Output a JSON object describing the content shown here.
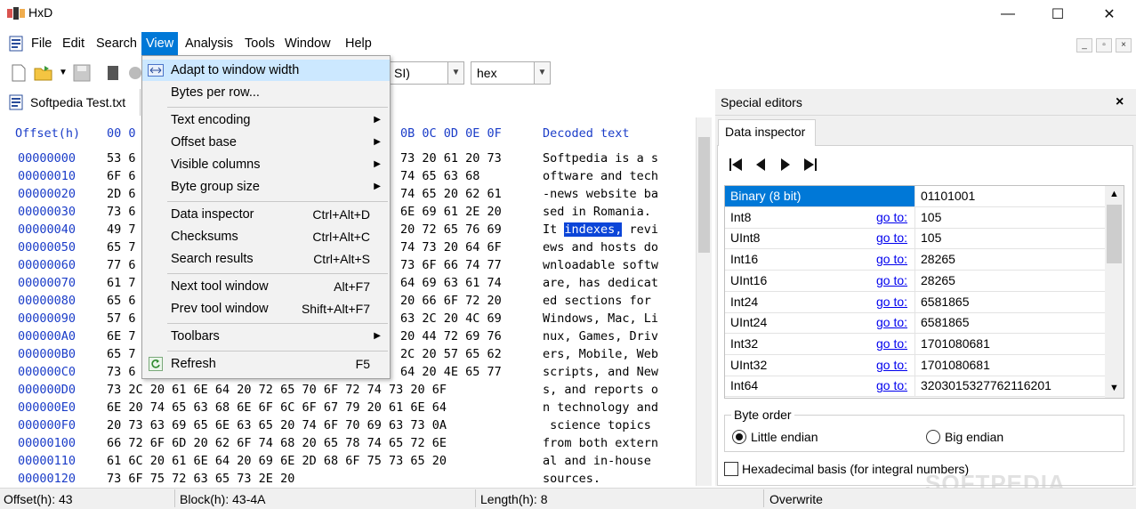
{
  "window": {
    "title": "HxD",
    "minimize": "—",
    "maximize": "☐",
    "close": "✕"
  },
  "menubar": {
    "items": [
      "File",
      "Edit",
      "Search",
      "View",
      "Analysis",
      "Tools",
      "Window",
      "Help"
    ],
    "active": "View"
  },
  "toolbar": {
    "encoding_value": "SI)",
    "base_value": "hex"
  },
  "document_tab": {
    "label": "Softpedia Test.txt"
  },
  "hex": {
    "header_offset": "Offset(h)",
    "header_cols_left": "00 0",
    "header_cols_right": "0B 0C 0D 0E 0F",
    "header_decoded": "Decoded text",
    "rows": [
      {
        "offset": "00000000",
        "left": "53 6",
        "right": "73 20 61 20 73",
        "text": "Softpedia is a s"
      },
      {
        "offset": "00000010",
        "left": "6F 6",
        "right": "74 65 63 68",
        "text": "oftware and tech"
      },
      {
        "offset": "00000020",
        "left": "2D 6",
        "right": "74 65 20 62 61",
        "text": "-news website ba"
      },
      {
        "offset": "00000030",
        "left": "73 6",
        "right": "6E 69 61 2E 20",
        "text": "sed in Romania. "
      },
      {
        "offset": "00000040",
        "left": "49 7",
        "right": "20 72 65 76 69",
        "text_pre": "It ",
        "text_sel": "indexes,",
        "text_post": " revi"
      },
      {
        "offset": "00000050",
        "left": "65 7",
        "right": "74 73 20 64 6F",
        "text": "ews and hosts do"
      },
      {
        "offset": "00000060",
        "left": "77 6",
        "right": "73 6F 66 74 77",
        "text": "wnloadable softw"
      },
      {
        "offset": "00000070",
        "left": "61 7",
        "right": "64 69 63 61 74",
        "text": "are, has dedicat"
      },
      {
        "offset": "00000080",
        "left": "65 6",
        "right": "20 66 6F 72 20",
        "text": "ed sections for "
      },
      {
        "offset": "00000090",
        "left": "57 6",
        "right": "63 2C 20 4C 69",
        "text": "Windows, Mac, Li"
      },
      {
        "offset": "000000A0",
        "left": "6E 7",
        "right": "20 44 72 69 76",
        "text": "nux, Games, Driv"
      },
      {
        "offset": "000000B0",
        "left": "65 7",
        "right": "2C 20 57 65 62",
        "text": "ers, Mobile, Web"
      },
      {
        "offset": "000000C0",
        "left": "73 6",
        "right": "64 20 4E 65 77",
        "text": "scripts, and New"
      },
      {
        "offset": "000000D0",
        "full": "73 2C 20 61 6E 64 20 72 65 70 6F 72 74 73 20 6F",
        "text": "s, and reports o"
      },
      {
        "offset": "000000E0",
        "full": "6E 20 74 65 63 68 6E 6F 6C 6F 67 79 20 61 6E 64",
        "text": "n technology and"
      },
      {
        "offset": "000000F0",
        "full": "20 73 63 69 65 6E 63 65 20 74 6F 70 69 63 73 0A",
        "text": " science topics "
      },
      {
        "offset": "00000100",
        "full": "66 72 6F 6D 20 62 6F 74 68 20 65 78 74 65 72 6E",
        "text": "from both extern"
      },
      {
        "offset": "00000110",
        "full": "61 6C 20 61 6E 64 20 69 6E 2D 68 6F 75 73 65 20",
        "text": "al and in-house "
      },
      {
        "offset": "00000120",
        "full": "73 6F 75 72 63 65 73 2E 20",
        "text": "sources. "
      }
    ]
  },
  "view_menu": {
    "items": [
      {
        "label": "Adapt to window width",
        "shortcut": "",
        "submenu": false,
        "icon": true
      },
      {
        "label": "Bytes per row...",
        "shortcut": "",
        "submenu": false
      },
      {
        "label": "Text encoding",
        "shortcut": "",
        "submenu": true
      },
      {
        "label": "Offset base",
        "shortcut": "",
        "submenu": true
      },
      {
        "label": "Visible columns",
        "shortcut": "",
        "submenu": true
      },
      {
        "label": "Byte group size",
        "shortcut": "",
        "submenu": true
      },
      {
        "label": "Data inspector",
        "shortcut": "Ctrl+Alt+D",
        "submenu": false
      },
      {
        "label": "Checksums",
        "shortcut": "Ctrl+Alt+C",
        "submenu": false
      },
      {
        "label": "Search results",
        "shortcut": "Ctrl+Alt+S",
        "submenu": false
      },
      {
        "label": "Next tool window",
        "shortcut": "Alt+F7",
        "submenu": false
      },
      {
        "label": "Prev tool window",
        "shortcut": "Shift+Alt+F7",
        "submenu": false
      },
      {
        "label": "Toolbars",
        "shortcut": "",
        "submenu": true
      },
      {
        "label": "Refresh",
        "shortcut": "F5",
        "submenu": false,
        "icon": true
      }
    ]
  },
  "special_editors": {
    "title": "Special editors",
    "close": "×",
    "tab_label": "Data inspector",
    "goto_label": "go to:",
    "rows": [
      {
        "name": "Binary (8 bit)",
        "value": "01101001",
        "goto": false
      },
      {
        "name": "Int8",
        "value": "105",
        "goto": true
      },
      {
        "name": "UInt8",
        "value": "105",
        "goto": true
      },
      {
        "name": "Int16",
        "value": "28265",
        "goto": true
      },
      {
        "name": "UInt16",
        "value": "28265",
        "goto": true
      },
      {
        "name": "Int24",
        "value": "6581865",
        "goto": true
      },
      {
        "name": "UInt24",
        "value": "6581865",
        "goto": true
      },
      {
        "name": "Int32",
        "value": "1701080681",
        "goto": true
      },
      {
        "name": "UInt32",
        "value": "1701080681",
        "goto": true
      },
      {
        "name": "Int64",
        "value": "3203015327762116201",
        "goto": true
      }
    ],
    "byte_order_label": "Byte order",
    "little_endian": "Little endian",
    "big_endian": "Big endian",
    "hex_basis_label": "Hexadecimal basis (for integral numbers)"
  },
  "statusbar": {
    "offset": "Offset(h): 43",
    "block": "Block(h): 43-4A",
    "length": "Length(h): 8",
    "mode": "Overwrite"
  },
  "watermark": "SOFTPEDIA",
  "colors": {
    "accent": "#0078d7",
    "hex_blue": "#1a3cc8",
    "selection": "#0b45d8"
  }
}
